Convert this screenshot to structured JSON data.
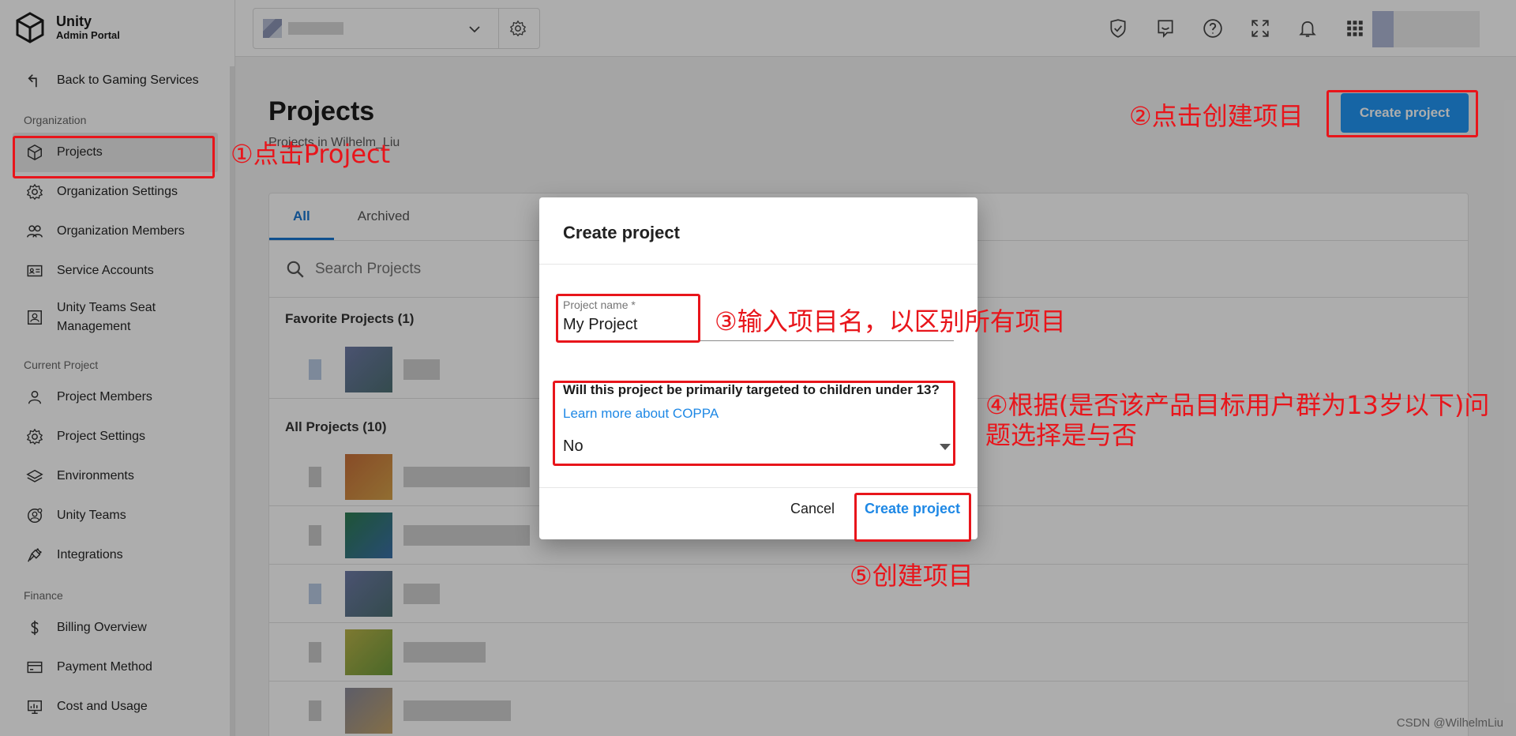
{
  "brand": {
    "name": "Unity",
    "sub": "Admin Portal"
  },
  "sidebar": {
    "back": "Back to Gaming Services",
    "sections": {
      "organization": "Organization",
      "current_project": "Current Project",
      "finance": "Finance"
    },
    "items": {
      "projects": "Projects",
      "org_settings": "Organization Settings",
      "org_members": "Organization Members",
      "service_accounts": "Service Accounts",
      "teams_seat": "Unity Teams Seat Management",
      "project_members": "Project Members",
      "project_settings": "Project Settings",
      "environments": "Environments",
      "unity_teams": "Unity Teams",
      "integrations": "Integrations",
      "billing": "Billing Overview",
      "payment": "Payment Method",
      "cost_usage": "Cost and Usage"
    },
    "active": "projects"
  },
  "topbar": {
    "icons": [
      "shield-check-icon",
      "feedback-icon",
      "help-icon",
      "fullscreen-icon",
      "bell-icon",
      "apps-grid-icon"
    ]
  },
  "main": {
    "title": "Projects",
    "subtitle": "Projects in Wilhelm_Liu",
    "create_button": "Create project",
    "tabs": [
      "All",
      "Archived"
    ],
    "active_tab": "All",
    "search_placeholder": "Search Projects",
    "favorites_title": "Favorite Projects (1)",
    "all_title": "All Projects (10)"
  },
  "dialog": {
    "title": "Create project",
    "name_label": "Project name *",
    "name_value": "My Project",
    "question": "Will this project be primarily targeted to children under 13?",
    "coppa_link": "Learn more about COPPA",
    "coppa_value": "No",
    "cancel": "Cancel",
    "create": "Create project"
  },
  "annotations": {
    "step1": "①点击Project",
    "step2": "②点击创建项目",
    "step3": "③输入项目名，以区别所有项目",
    "step4": "④根据(是否该产品目标用户群为13岁以下)问题选择是与否",
    "step5": "⑤创建项目",
    "color": "#e8151b"
  },
  "watermark": "CSDN @WilhelmLiu",
  "colors": {
    "accent": "#2196f3",
    "link": "#1e88e5",
    "tab_active": "#1976d2"
  }
}
